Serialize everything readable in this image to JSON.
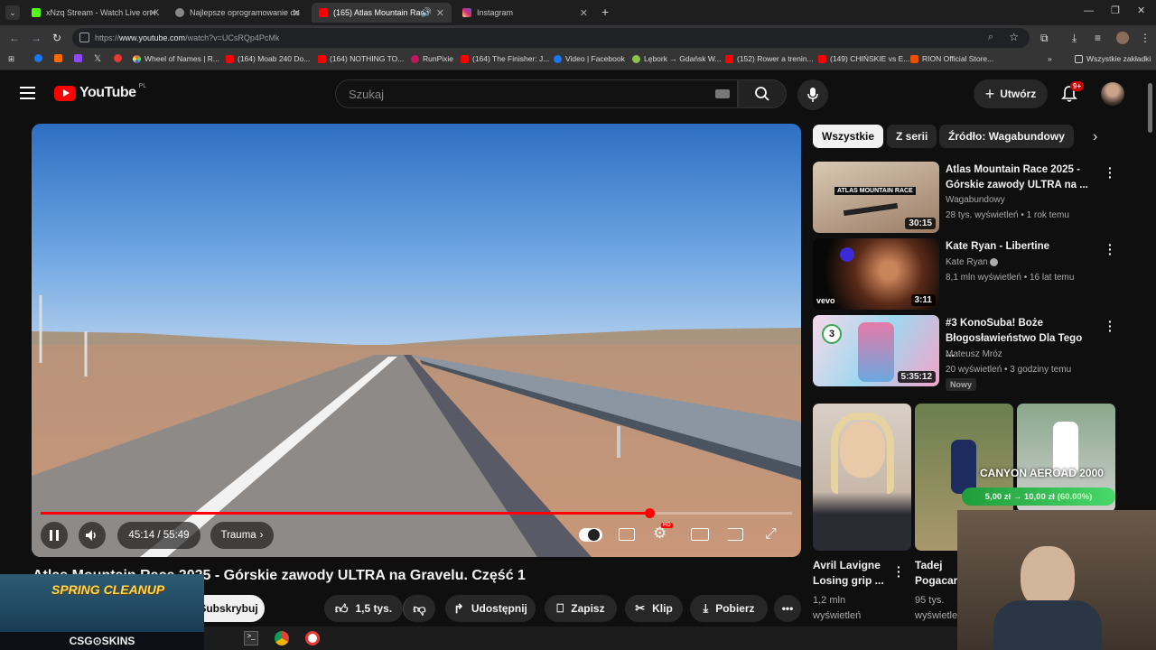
{
  "browser": {
    "tabs": [
      {
        "label": "xNzq Stream - Watch Live on K",
        "color": "#53fc18"
      },
      {
        "label": "Najlepsze oprogramowanie do",
        "color": "#5f6368"
      },
      {
        "label": "(165) Atlas Mountain Race",
        "color": "#ff0000"
      },
      {
        "label": "Instagram",
        "color": "#e1306c"
      }
    ],
    "url_prefix": "https://",
    "url_domain": "www.youtube.com",
    "url_path": "/watch?v=UCsRQp4PcMk",
    "bookmarks": [
      "Wheel of Names | R...",
      "(164) Moab 240 Do...",
      "(164) NOTHING TO...",
      "RunPixie",
      "(164) The Finisher: J...",
      "Video | Facebook",
      "Lębork → Gdańsk W...",
      "(152) Rower a trenin...",
      "(149) CHIŃSKIE vs E...",
      "RION Official Store..."
    ],
    "all_bookmarks": "Wszystkie zakładki"
  },
  "header": {
    "logo_text": "YouTube",
    "region": "PL",
    "search_placeholder": "Szukaj",
    "create_label": "Utwórz",
    "notif_badge": "9+"
  },
  "player": {
    "time_current": "45:14",
    "time_total": "55:49",
    "time_display": "45:14 / 55:49",
    "chapter": "Trauma",
    "progress": 0.81,
    "quality_badge": "HD"
  },
  "video": {
    "title": "Atlas Mountain Race 2025 - Górskie zawody ULTRA na Gravelu. Część 1",
    "subscribe": "Subskrybuj",
    "likes": "1,5 tys.",
    "share": "Udostępnij",
    "save": "Zapisz",
    "clip": "Klip",
    "download": "Pobierz"
  },
  "chips": [
    "Wszystkie",
    "Z serii",
    "Źródło: Wagabundowy"
  ],
  "recommendations": [
    {
      "title_line1": "Atlas Mountain Race 2025 -",
      "title_line2": "Górskie zawody ULTRA na ...",
      "channel": "Wagabundowy",
      "meta": "28 tys. wyświetleń • 1 rok temu",
      "duration": "30:15",
      "thumb_text": "ATLAS MOUNTAIN RACE"
    },
    {
      "title_line1": "Kate Ryan - Libertine",
      "title_line2": "",
      "channel": "Kate Ryan",
      "meta": "8,1 mln wyświetleń • 16 lat temu",
      "duration": "3:11",
      "thumb_text": "vevo"
    },
    {
      "title_line1": "#3 KonoSuba! Boże",
      "title_line2": "Błogosławieństwo Dla Tego ...",
      "channel": "Mateusz Mróz",
      "meta": "20 wyświetleń • 3 godziny temu",
      "duration": "5:35:12",
      "badge": "Nowy",
      "thumb_text": "3"
    }
  ],
  "shorts": [
    {
      "title_line1": "Avril Lavigne",
      "title_line2": "Losing grip ...",
      "views_line1": "1,2 mln",
      "views_line2": "wyświetleń"
    },
    {
      "title_line1": "Tadej",
      "title_line2": "Pogacar",
      "views_line1": "95 tys.",
      "views_line2": "wyświetleń"
    }
  ],
  "overlays": {
    "promo_title": "CANYON AEROAD 2000",
    "promo_price": "5,00 zł → 10,00 zł",
    "promo_pct": "(60.00%)",
    "stream_banner": "SPRING CLEANUP",
    "stream_brand": "CSG⊙SKINS"
  }
}
